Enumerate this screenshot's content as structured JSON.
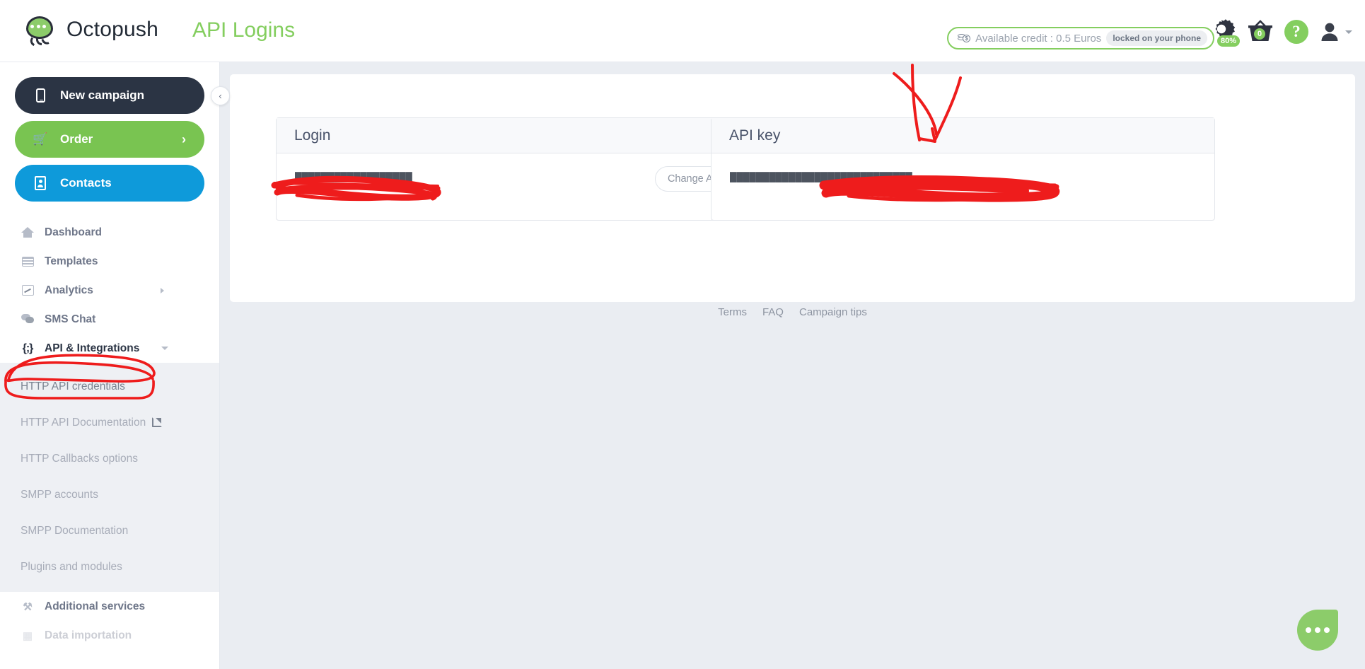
{
  "header": {
    "brand_name": "Octopush",
    "logo_icon": "octopus-logo-icon",
    "page_title": "API Logins",
    "credit": {
      "coin_icon": "coin-stack-icon",
      "text": "Available credit : 0.5 Euros",
      "badge": "locked on your phone"
    },
    "icons": {
      "gear": {
        "name": "gear-icon",
        "badge": "80%"
      },
      "basket": {
        "name": "basket-icon",
        "badge": "0"
      },
      "help": {
        "name": "help-icon",
        "glyph": "?"
      },
      "avatar": {
        "name": "user-avatar-icon"
      },
      "caret": {
        "name": "chevron-down-icon"
      }
    }
  },
  "sidebar": {
    "collapse_toggle": "‹",
    "buttons": [
      {
        "label": "New campaign",
        "icon": "mobile-phone-icon",
        "style": "dark"
      },
      {
        "label": "Order",
        "icon": "shopping-cart-icon",
        "style": "green",
        "chevron": "›"
      },
      {
        "label": "Contacts",
        "icon": "contact-book-icon",
        "style": "blue"
      }
    ],
    "items": [
      {
        "label": "Dashboard",
        "icon": "home-icon"
      },
      {
        "label": "Templates",
        "icon": "template-icon"
      },
      {
        "label": "Analytics",
        "icon": "chart-icon",
        "caret": "right"
      },
      {
        "label": "SMS Chat",
        "icon": "chat-bubbles-icon"
      },
      {
        "label": "API & Integrations",
        "icon": "code-braces-icon",
        "caret": "down",
        "expanded": true,
        "annotated": true
      }
    ],
    "subitems": [
      {
        "label": "HTTP API credentials",
        "selected": true
      },
      {
        "label": "HTTP API Documentation",
        "external": true
      },
      {
        "label": "HTTP Callbacks options"
      },
      {
        "label": "SMPP accounts"
      },
      {
        "label": "SMPP Documentation"
      },
      {
        "label": "Plugins and modules"
      }
    ],
    "items_after": [
      {
        "label": "Additional services",
        "icon": "tools-icon"
      },
      {
        "label": "Data importation",
        "icon": "database-icon",
        "cut_off": true
      }
    ]
  },
  "main": {
    "cards": [
      {
        "title": "Login",
        "value": "██████████████████",
        "value_redacted": true,
        "button": "Change API login"
      },
      {
        "title": "API key",
        "value": "████████████████████████████",
        "value_redacted": true
      }
    ],
    "footer_links": [
      "Terms",
      "FAQ",
      "Campaign tips"
    ],
    "chat_fab": "chat-bubble-icon"
  },
  "annotations": {
    "color": "#ee1c1c",
    "marks": [
      "red-circle-around-api-integrations",
      "red-scribble-over-login-value",
      "red-scribble-over-api-key-value",
      "red-arrow-pointing-to-api-key-card"
    ]
  }
}
